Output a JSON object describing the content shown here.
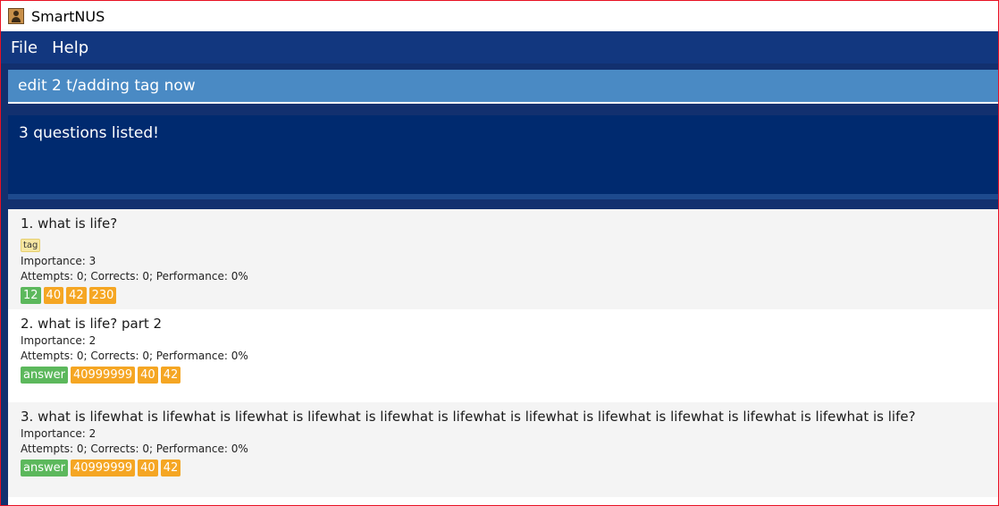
{
  "window": {
    "title": "SmartNUS"
  },
  "menu": {
    "file": "File",
    "help": "Help"
  },
  "command": {
    "value": "edit 2 t/adding tag now"
  },
  "result": {
    "text": "3 questions listed!"
  },
  "questions": [
    {
      "title": "1. what is life?",
      "tags": [
        "tag"
      ],
      "importance": "Importance: 3",
      "stats": "Attempts: 0; Corrects: 0; Performance: 0%",
      "options": [
        {
          "label": "12",
          "status": "correct"
        },
        {
          "label": "40",
          "status": "wrong"
        },
        {
          "label": "42",
          "status": "wrong"
        },
        {
          "label": "230",
          "status": "wrong"
        }
      ]
    },
    {
      "title": "2. what is life? part 2",
      "tags": [],
      "importance": "Importance: 2",
      "stats": "Attempts: 0; Corrects: 0; Performance: 0%",
      "options": [
        {
          "label": "answer",
          "status": "correct"
        },
        {
          "label": "40999999",
          "status": "wrong"
        },
        {
          "label": "40",
          "status": "wrong"
        },
        {
          "label": "42",
          "status": "wrong"
        }
      ]
    },
    {
      "title": "3. what is lifewhat is lifewhat is lifewhat is lifewhat is lifewhat is lifewhat is lifewhat is lifewhat is lifewhat is lifewhat is lifewhat is life?",
      "tags": [],
      "importance": "Importance: 2",
      "stats": "Attempts: 0; Corrects: 0; Performance: 0%",
      "options": [
        {
          "label": "answer",
          "status": "correct"
        },
        {
          "label": "40999999",
          "status": "wrong"
        },
        {
          "label": "40",
          "status": "wrong"
        },
        {
          "label": "42",
          "status": "wrong"
        }
      ]
    }
  ],
  "colors": {
    "correct": "#5cb85c",
    "wrong": "#f5a623",
    "menubar": "#12377f",
    "command_box": "#4a8ac4",
    "result_box": "#002a6f",
    "window_border": "#e81123"
  },
  "icons": {
    "app": "address-book-icon"
  }
}
